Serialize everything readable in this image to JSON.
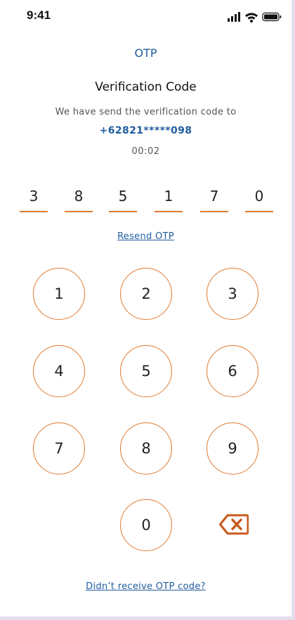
{
  "status_bar": {
    "time": "9:41",
    "icons": [
      "signal-icon",
      "wifi-icon",
      "battery-icon"
    ]
  },
  "header": {
    "title": "OTP"
  },
  "verification": {
    "heading": "Verification Code",
    "description": "We have send the verification code to",
    "phone": "+62821*****098",
    "timer": "00:02"
  },
  "otp": {
    "digits": [
      "3",
      "8",
      "5",
      "1",
      "7",
      "0"
    ]
  },
  "resend_label": "Resend OTP",
  "keypad": {
    "keys": [
      "1",
      "2",
      "3",
      "4",
      "5",
      "6",
      "7",
      "8",
      "9",
      "0"
    ],
    "backspace_icon": "backspace-icon"
  },
  "footer": {
    "no_code_label": "Didn’t receive OTP code?"
  },
  "colors": {
    "accent": "#e07a30",
    "link": "#1f5c9e",
    "frame": "#e6def0"
  }
}
